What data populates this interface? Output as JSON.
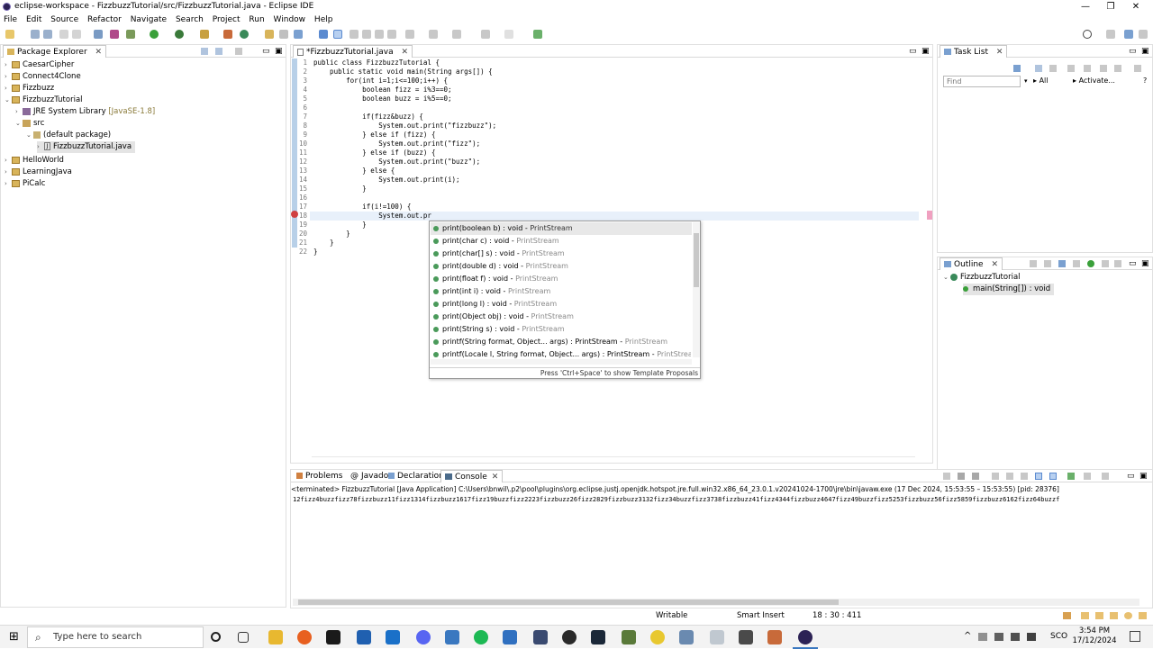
{
  "window": {
    "title": "eclipse-workspace - FizzbuzzTutorial/src/FizzbuzzTutorial.java - Eclipse IDE",
    "minimize": "—",
    "restore": "❐",
    "close": "✕"
  },
  "menu": [
    "File",
    "Edit",
    "Source",
    "Refactor",
    "Navigate",
    "Search",
    "Project",
    "Run",
    "Window",
    "Help"
  ],
  "package_explorer": {
    "title": "Package Explorer",
    "items": [
      {
        "label": "CaesarCipher",
        "extra": ""
      },
      {
        "label": "Connect4Clone",
        "extra": ""
      },
      {
        "label": "Fizzbuzz",
        "extra": ""
      },
      {
        "label": "FizzbuzzTutorial",
        "extra": ""
      },
      {
        "label": "JRE System Library",
        "extra": "[JavaSE-1.8]"
      },
      {
        "label": "src",
        "extra": ""
      },
      {
        "label": "(default package)",
        "extra": ""
      },
      {
        "label": "FizzbuzzTutorial.java",
        "extra": ""
      },
      {
        "label": "HelloWorld",
        "extra": ""
      },
      {
        "label": "LearningJava",
        "extra": ""
      },
      {
        "label": "PiCalc",
        "extra": ""
      }
    ]
  },
  "editor": {
    "tab_label": "*FizzbuzzTutorial.java",
    "line_numbers": [
      "1",
      "2",
      "3",
      "4",
      "5",
      "6",
      "7",
      "8",
      "9",
      "10",
      "11",
      "12",
      "13",
      "14",
      "15",
      "16",
      "17",
      "18",
      "19",
      "20",
      "21",
      "22"
    ],
    "lines": [
      "public class FizzbuzzTutorial {",
      "    public static void main(String args[]) {",
      "        for(int i=1;i<=100;i++) {",
      "            boolean fizz = i%3==0;",
      "            boolean buzz = i%5==0;",
      "",
      "            if(fizz&buzz) {",
      "                System.out.print(\"fizzbuzz\");",
      "            } else if (fizz) {",
      "                System.out.print(\"fizz\");",
      "            } else if (buzz) {",
      "                System.out.print(\"buzz\");",
      "            } else {",
      "                System.out.print(i);",
      "            }",
      "",
      "            if(i!=100) {",
      "                System.out.pr",
      "            }",
      "        }",
      "    }",
      "}"
    ]
  },
  "autocomplete": {
    "proposals": [
      {
        "sig": "print(boolean b) : void",
        "cls": "PrintStream"
      },
      {
        "sig": "print(char c) : void",
        "cls": "PrintStream"
      },
      {
        "sig": "print(char[] s) : void",
        "cls": "PrintStream"
      },
      {
        "sig": "print(double d) : void",
        "cls": "PrintStream"
      },
      {
        "sig": "print(float f) : void",
        "cls": "PrintStream"
      },
      {
        "sig": "print(int i) : void",
        "cls": "PrintStream"
      },
      {
        "sig": "print(long l) : void",
        "cls": "PrintStream"
      },
      {
        "sig": "print(Object obj) : void",
        "cls": "PrintStream"
      },
      {
        "sig": "print(String s) : void",
        "cls": "PrintStream"
      },
      {
        "sig": "printf(String format, Object... args) : PrintStream",
        "cls": "PrintStream"
      },
      {
        "sig": "printf(Locale l, String format, Object... args) : PrintStream",
        "cls": "PrintStream"
      }
    ],
    "hint": "Press 'Ctrl+Space' to show Template Proposals"
  },
  "task_list": {
    "title": "Task List",
    "find_placeholder": "Find",
    "all": "All",
    "activate": "Activate..."
  },
  "outline": {
    "title": "Outline",
    "class_name": "FizzbuzzTutorial",
    "method": "main(String[]) : void"
  },
  "console": {
    "tabs": [
      "Problems",
      "Javadoc",
      "Declaration",
      "Console"
    ],
    "terminated": "<terminated> FizzbuzzTutorial [Java Application] C:\\Users\\bnwil\\.p2\\pool\\plugins\\org.eclipse.justj.openjdk.hotspot.jre.full.win32.x86_64_23.0.1.v20241024-1700\\jre\\bin\\javaw.exe  (17 Dec 2024, 15:53:55 – 15:53:55) [pid: 28376]",
    "output": "12fizz4buzzfizz78fizzbuzz11fizz1314fizzbuzz1617fizz19buzzfizz2223fizzbuzz26fizz2829fizzbuzz3132fizz34buzzfizz3738fizzbuzz41fizz4344fizzbuzz4647fizz49buzzfizz5253fizzbuzz56fizz5859fizzbuzz6162fizz64buzzf"
  },
  "status_bar": {
    "writable": "Writable",
    "insert_mode": "Smart Insert",
    "position": "18 : 30 : 411"
  },
  "taskbar": {
    "search_placeholder": "Type here to search",
    "time": "3:54 PM",
    "date": "17/12/2024",
    "lang": "SCO"
  }
}
